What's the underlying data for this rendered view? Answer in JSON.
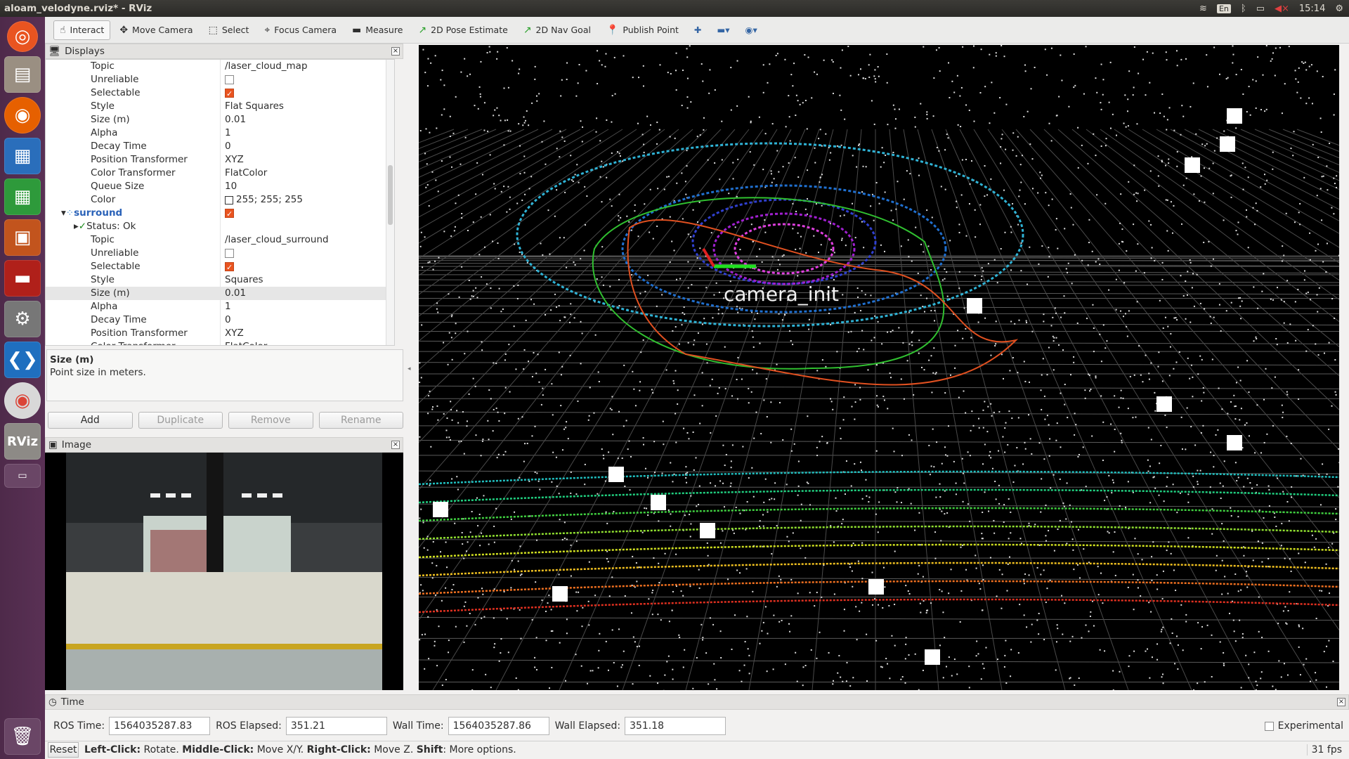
{
  "window": {
    "title": "aloam_velodyne.rviz* - RViz"
  },
  "tray": {
    "lang": "En",
    "time": "15:14"
  },
  "launcher": {
    "items": [
      "ubuntu-dash-icon",
      "files-icon",
      "firefox-icon",
      "writer-icon",
      "calc-icon",
      "impress-icon",
      "software-icon",
      "settings-icon",
      "vscode-icon",
      "chrome-icon",
      "rviz-icon",
      "workspace-icon"
    ],
    "rviz_label": "RViz"
  },
  "toolbar": {
    "tools": [
      {
        "label": "Interact",
        "icon": "hand-icon",
        "glyph": "☝",
        "active": true
      },
      {
        "label": "Move Camera",
        "icon": "move-camera-icon",
        "glyph": "✥",
        "active": false
      },
      {
        "label": "Select",
        "icon": "select-icon",
        "glyph": "⬚",
        "active": false
      },
      {
        "label": "Focus Camera",
        "icon": "focus-camera-icon",
        "glyph": "⌖",
        "active": false
      },
      {
        "label": "Measure",
        "icon": "measure-icon",
        "glyph": "▬",
        "active": false
      },
      {
        "label": "2D Pose Estimate",
        "icon": "pose-estimate-icon",
        "glyph": "↗",
        "active": false
      },
      {
        "label": "2D Nav Goal",
        "icon": "nav-goal-icon",
        "glyph": "↗",
        "active": false
      },
      {
        "label": "Publish Point",
        "icon": "publish-point-icon",
        "glyph": "📍",
        "active": false
      }
    ],
    "extra": [
      "✚",
      "▬▾",
      "◉▾"
    ]
  },
  "displays": {
    "title": "Displays",
    "rows": [
      {
        "name": "Topic",
        "value": "/laser_cloud_map"
      },
      {
        "name": "Unreliable",
        "checkbox": false
      },
      {
        "name": "Selectable",
        "checkbox": true
      },
      {
        "name": "Style",
        "value": "Flat Squares"
      },
      {
        "name": "Size (m)",
        "value": "0.01"
      },
      {
        "name": "Alpha",
        "value": "1"
      },
      {
        "name": "Decay Time",
        "value": "0"
      },
      {
        "name": "Position Transformer",
        "value": "XYZ"
      },
      {
        "name": "Color Transformer",
        "value": "FlatColor"
      },
      {
        "name": "Queue Size",
        "value": "10"
      },
      {
        "name": "Color",
        "value": "255; 255; 255",
        "swatch": true
      },
      {
        "name": "surround",
        "checkbox": true,
        "group": true
      },
      {
        "name": "Status: Ok",
        "status": true
      },
      {
        "name": "Topic",
        "value": "/laser_cloud_surround"
      },
      {
        "name": "Unreliable",
        "checkbox": false
      },
      {
        "name": "Selectable",
        "checkbox": true
      },
      {
        "name": "Style",
        "value": "Squares"
      },
      {
        "name": "Size (m)",
        "value": "0.01",
        "selected": true
      },
      {
        "name": "Alpha",
        "value": "1"
      },
      {
        "name": "Decay Time",
        "value": "0"
      },
      {
        "name": "Position Transformer",
        "value": "XYZ"
      },
      {
        "name": "Color Transformer",
        "value": "FlatColor"
      }
    ],
    "desc_title": "Size (m)",
    "desc_text": "Point size in meters.",
    "buttons": {
      "add": "Add",
      "duplicate": "Duplicate",
      "remove": "Remove",
      "rename": "Rename"
    }
  },
  "image_panel": {
    "title": "Image"
  },
  "viewport": {
    "frame_label": "camera_init"
  },
  "time_panel": {
    "title": "Time",
    "ros_time_label": "ROS Time:",
    "ros_time": "1564035287.83",
    "ros_elapsed_label": "ROS Elapsed:",
    "ros_elapsed": "351.21",
    "wall_time_label": "Wall Time:",
    "wall_time": "1564035287.86",
    "wall_elapsed_label": "Wall Elapsed:",
    "wall_elapsed": "351.18",
    "experimental": "Experimental"
  },
  "status": {
    "reset": "Reset",
    "left": "Left-Click:",
    "left_t": " Rotate. ",
    "middle": "Middle-Click:",
    "middle_t": " Move X/Y. ",
    "right": "Right-Click:",
    "right_t": " Move Z. ",
    "shift": "Shift",
    "shift_t": ": More options.",
    "fps": "31 fps"
  }
}
